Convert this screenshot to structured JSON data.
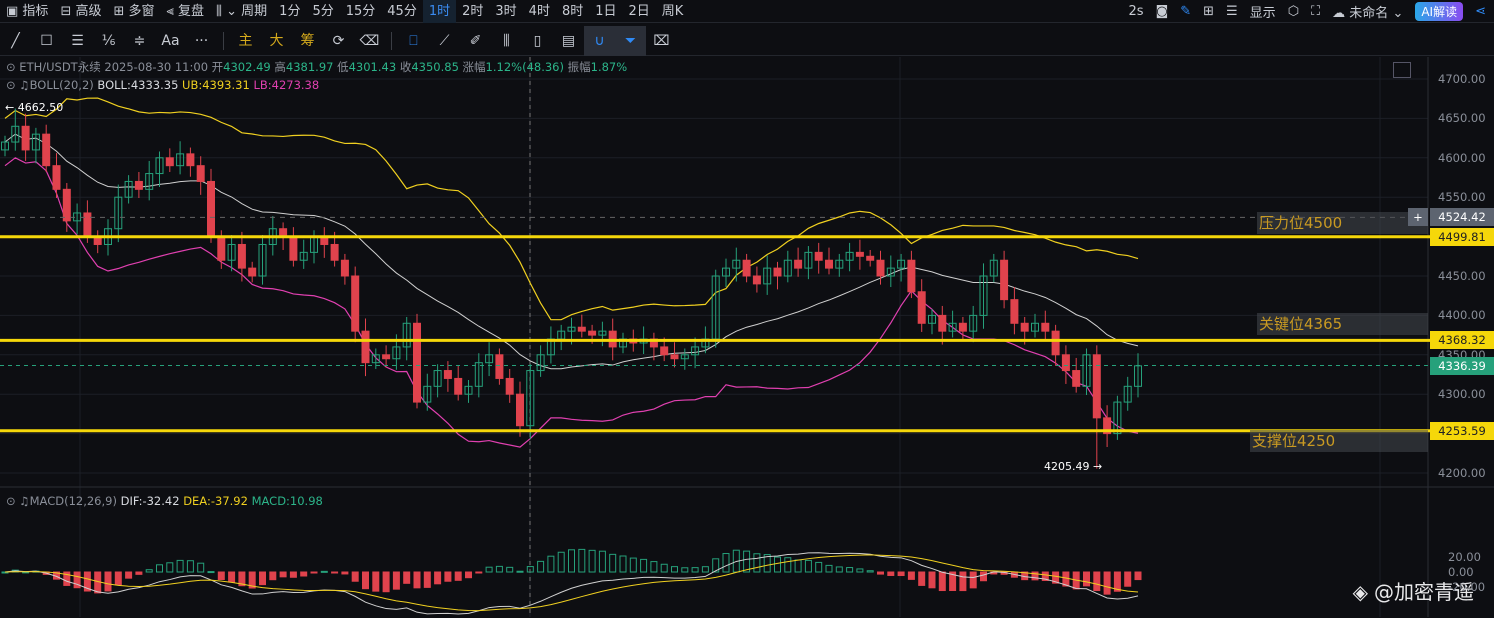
{
  "topbar": {
    "items": [
      "指标",
      "高级",
      "多窗",
      "复盘",
      "周期",
      "1分",
      "5分",
      "15分",
      "45分",
      "1时",
      "2时",
      "3时",
      "4时",
      "8时",
      "1日",
      "2日",
      "周K"
    ],
    "active": "1时",
    "right": {
      "refresh": "2s",
      "display": "显示",
      "layout": "未命名",
      "ai": "AI解读"
    }
  },
  "toolbar": {
    "main": "主",
    "big": "大",
    "chip": "筹",
    "text": "Aa",
    "more": "···"
  },
  "info": {
    "symbol": "ETH/USDT永续",
    "datetime": "2025-08-30 11:00",
    "open_label": "开",
    "open": "4302.49",
    "high_label": "高",
    "high": "4381.97",
    "low_label": "低",
    "low": "4301.43",
    "close_label": "收",
    "close": "4350.85",
    "change_label": "涨幅",
    "change": "1.12%(48.36)",
    "amp_label": "振幅",
    "amp": "1.87%"
  },
  "boll": {
    "label": "BOLL(20,2)",
    "mid": "BOLL:4333.35",
    "ub": "UB:4393.31",
    "lb": "LB:4273.38"
  },
  "macd": {
    "label": "MACD(12,26,9)",
    "dif": "DIF:-32.42",
    "dea": "DEA:-37.92",
    "macd": "MACD:10.98"
  },
  "levels": [
    {
      "text": "压力位4500",
      "price": 4499.81,
      "label": "4499.81"
    },
    {
      "text": "关键位4365",
      "price": 4368.32,
      "label": "4368.32"
    },
    {
      "text": "支撑位4250",
      "price": 4253.59,
      "label": "4253.59"
    }
  ],
  "marker_price": {
    "price": 4524.42,
    "label": "4524.42"
  },
  "last_price": {
    "price": 4336.39,
    "label": "4336.39"
  },
  "extremes": {
    "high": "4662.50",
    "low": "4205.49"
  },
  "watermark": "@加密青遥",
  "colors": {
    "up": "#26a17b",
    "down": "#e0434d",
    "level": "#f5d70a",
    "mid": "#d0d0d0",
    "ub": "#f0d020",
    "lb": "#e040b0"
  },
  "chart_data": {
    "type": "candlestick",
    "ylim": [
      4200,
      4700
    ],
    "yticks": [
      "4700.00",
      "4650.00",
      "4600.00",
      "4550.00",
      "4450.00",
      "4400.00",
      "4350.00",
      "4300.00",
      "4200.00"
    ],
    "macd_ticks": [
      "20.00",
      "0.00",
      "-20.00"
    ],
    "closes": [
      4620,
      4640,
      4610,
      4630,
      4590,
      4560,
      4520,
      4530,
      4500,
      4490,
      4510,
      4550,
      4570,
      4560,
      4580,
      4600,
      4590,
      4605,
      4590,
      4570,
      4500,
      4470,
      4490,
      4460,
      4450,
      4490,
      4510,
      4500,
      4470,
      4480,
      4500,
      4490,
      4470,
      4450,
      4380,
      4340,
      4350,
      4345,
      4360,
      4390,
      4290,
      4310,
      4330,
      4320,
      4300,
      4310,
      4340,
      4350,
      4320,
      4300,
      4260,
      4330,
      4350,
      4370,
      4380,
      4385,
      4380,
      4375,
      4380,
      4360,
      4370,
      4365,
      4370,
      4360,
      4350,
      4345,
      4350,
      4360,
      4370,
      4450,
      4460,
      4470,
      4450,
      4440,
      4460,
      4450,
      4470,
      4460,
      4480,
      4470,
      4460,
      4470,
      4480,
      4475,
      4470,
      4450,
      4460,
      4470,
      4430,
      4390,
      4400,
      4380,
      4390,
      4380,
      4400,
      4450,
      4470,
      4420,
      4390,
      4380,
      4390,
      4380,
      4350,
      4330,
      4310,
      4350,
      4270,
      4250,
      4290,
      4310,
      4336
    ]
  }
}
